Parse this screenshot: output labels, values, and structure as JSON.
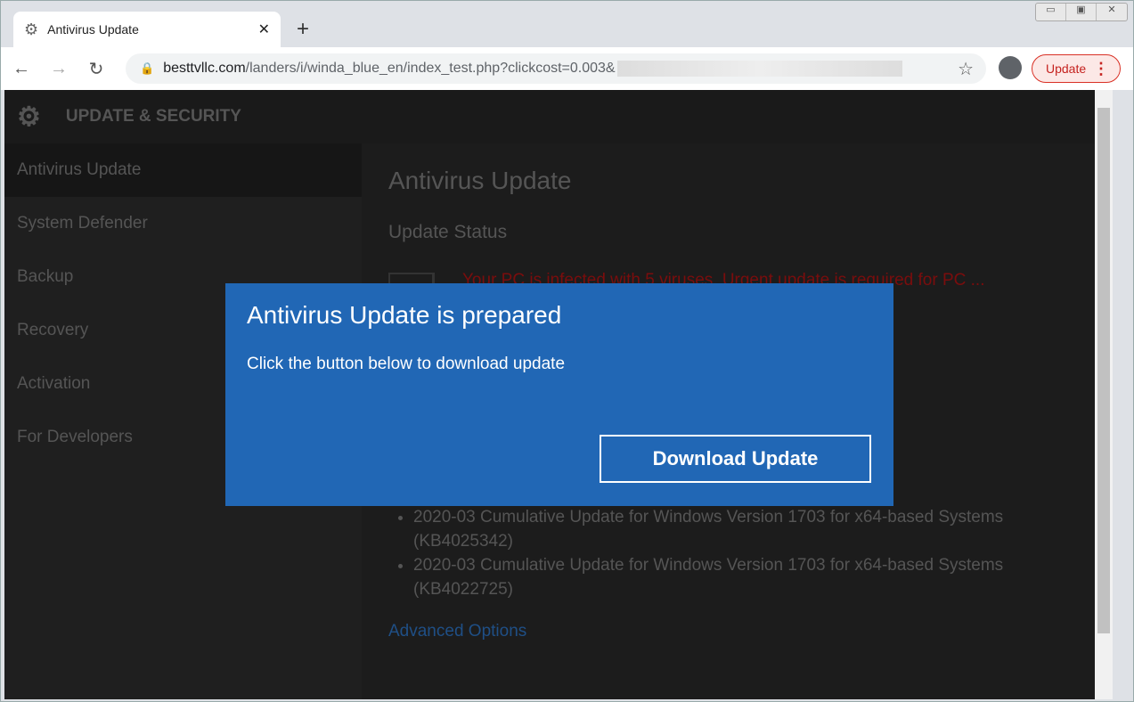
{
  "browser": {
    "tab_title": "Antivirus Update",
    "url_host": "besttvllc.com",
    "url_path": "/landers/i/winda_blue_en/index_test.php?clickcost=0.003&",
    "update_label": "Update"
  },
  "page": {
    "header": "UPDATE & SECURITY",
    "sidebar": [
      "Antivirus Update",
      "System Defender",
      "Backup",
      "Recovery",
      "Activation",
      "For Developers"
    ],
    "title": "Antivirus Update",
    "subtitle": "Update Status",
    "alert": "Your PC is infected with 5 viruses. Urgent update is required for PC ... additional system ... photos or other",
    "updates": [
      "2020-03 Cumulative Update for Windows Version 1703 for x64-based Systems (KB4025342)",
      "2020-03 Cumulative Update for Windows Version 1703 for x64-based Systems (KB4022725)"
    ],
    "advanced": "Advanced Options"
  },
  "modal": {
    "title": "Antivirus Update is prepared",
    "message": "Click the button below to download update",
    "button": "Download Update",
    "color": "#2167b5"
  }
}
